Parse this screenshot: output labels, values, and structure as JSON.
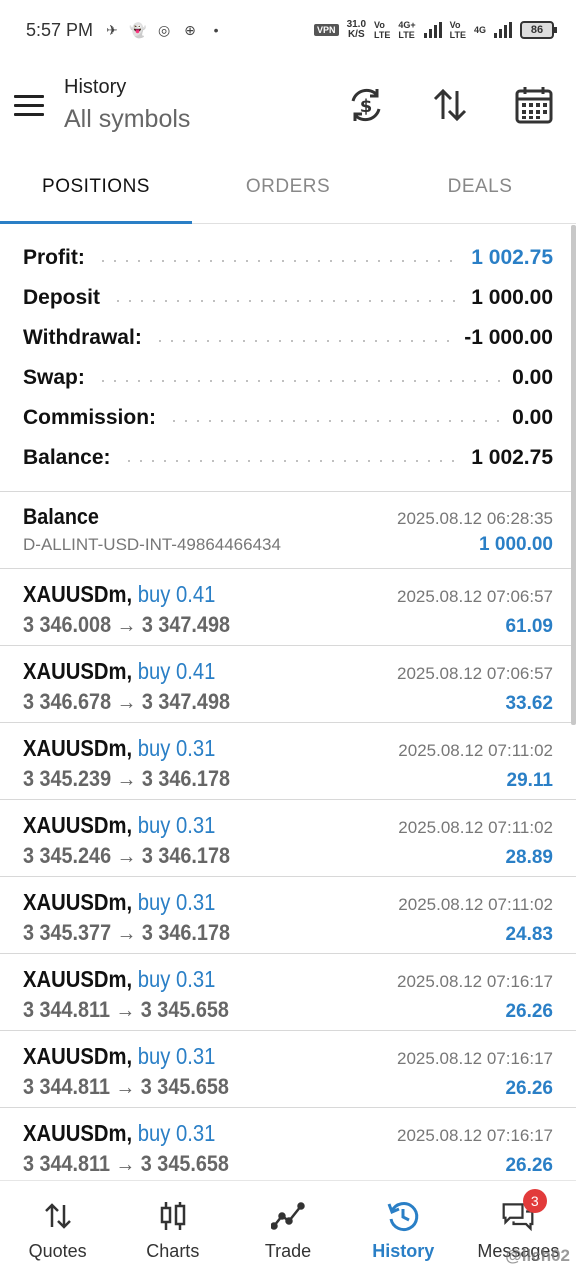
{
  "status_bar": {
    "time": "5:57 PM",
    "vpn": "VPN",
    "speed_value": "31.0",
    "speed_unit": "K/S",
    "sig1_top": "Vo",
    "sig1_bottom": "LTE",
    "sig2_top": "4G+",
    "sig2_bottom": "LTE",
    "sig3_top": "Vo",
    "sig3_bottom": "LTE",
    "sig4_top": "4G",
    "battery": "86"
  },
  "header": {
    "title": "History",
    "subtitle": "All symbols"
  },
  "tabs": [
    {
      "label": "POSITIONS",
      "active": true
    },
    {
      "label": "ORDERS",
      "active": false
    },
    {
      "label": "DEALS",
      "active": false
    }
  ],
  "summary": {
    "profit": {
      "label": "Profit:",
      "value": "1 002.75"
    },
    "deposit": {
      "label": "Deposit",
      "value": "1 000.00"
    },
    "withdrawal": {
      "label": "Withdrawal:",
      "value": "-1 000.00"
    },
    "swap": {
      "label": "Swap:",
      "value": "0.00"
    },
    "commission": {
      "label": "Commission:",
      "value": "0.00"
    },
    "balance": {
      "label": "Balance:",
      "value": "1 002.75"
    }
  },
  "balance_entry": {
    "title": "Balance",
    "time": "2025.08.12 06:28:35",
    "account": "D-ALLINT-USD-INT-49864466434",
    "amount": "1 000.00"
  },
  "positions": [
    {
      "symbol": "XAUUSDm,",
      "direction": "buy 0.41",
      "time": "2025.08.12 07:06:57",
      "prices": "3 346.008 → 3 347.498",
      "profit": "61.09"
    },
    {
      "symbol": "XAUUSDm,",
      "direction": "buy 0.41",
      "time": "2025.08.12 07:06:57",
      "prices": "3 346.678 → 3 347.498",
      "profit": "33.62"
    },
    {
      "symbol": "XAUUSDm,",
      "direction": "buy 0.31",
      "time": "2025.08.12 07:11:02",
      "prices": "3 345.239 → 3 346.178",
      "profit": "29.11"
    },
    {
      "symbol": "XAUUSDm,",
      "direction": "buy 0.31",
      "time": "2025.08.12 07:11:02",
      "prices": "3 345.246 → 3 346.178",
      "profit": "28.89"
    },
    {
      "symbol": "XAUUSDm,",
      "direction": "buy 0.31",
      "time": "2025.08.12 07:11:02",
      "prices": "3 345.377 → 3 346.178",
      "profit": "24.83"
    },
    {
      "symbol": "XAUUSDm,",
      "direction": "buy 0.31",
      "time": "2025.08.12 07:16:17",
      "prices": "3 344.811 → 3 345.658",
      "profit": "26.26"
    },
    {
      "symbol": "XAUUSDm,",
      "direction": "buy 0.31",
      "time": "2025.08.12 07:16:17",
      "prices": "3 344.811 → 3 345.658",
      "profit": "26.26"
    },
    {
      "symbol": "XAUUSDm,",
      "direction": "buy 0.31",
      "time": "2025.08.12 07:16:17",
      "prices": "3 344.811 → 3 345.658",
      "profit": "26.26"
    }
  ],
  "bottom_nav": [
    {
      "label": "Quotes",
      "icon": "quotes-icon"
    },
    {
      "label": "Charts",
      "icon": "charts-icon"
    },
    {
      "label": "Trade",
      "icon": "trade-icon"
    },
    {
      "label": "History",
      "icon": "history-icon",
      "active": true
    },
    {
      "label": "Messages",
      "icon": "messages-icon",
      "badge": "3"
    }
  ],
  "watermark": "@llch02",
  "colors": {
    "accent": "#2a7fc6",
    "badge": "#e23b3b"
  }
}
